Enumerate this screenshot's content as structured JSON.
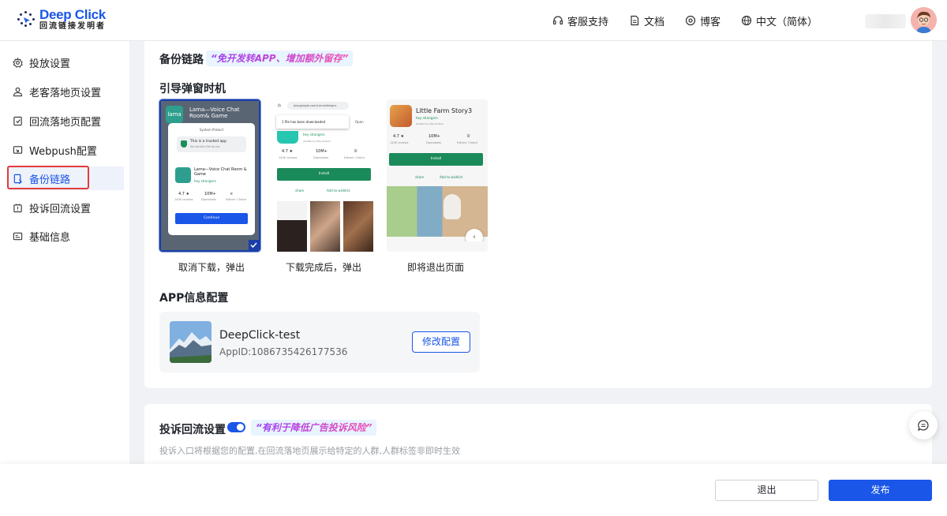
{
  "logo": {
    "brand": "Deep Click",
    "tagline": "回流链接发明者"
  },
  "nav": [
    {
      "label": "客服支持",
      "icon": "headset-icon"
    },
    {
      "label": "文档",
      "icon": "document-icon"
    },
    {
      "label": "博客",
      "icon": "compass-icon"
    },
    {
      "label": "中文（简体）",
      "icon": "globe-icon"
    }
  ],
  "sidebar": {
    "items": [
      {
        "label": "投放设置",
        "icon": "gear-icon"
      },
      {
        "label": "老客落地页设置",
        "icon": "user-cog-icon"
      },
      {
        "label": "回流落地页配置",
        "icon": "page-config-icon"
      },
      {
        "label": "Webpush配置",
        "icon": "push-icon"
      },
      {
        "label": "备份链路",
        "icon": "backup-icon",
        "active": true
      },
      {
        "label": "投诉回流设置",
        "icon": "complaint-icon"
      },
      {
        "label": "基础信息",
        "icon": "info-card-icon"
      }
    ]
  },
  "backup": {
    "title": "备份链路",
    "tag": "“免开发转APP、增加额外留存”",
    "popup_timing_title": "引导弹窗时机",
    "options": [
      {
        "caption": "取消下载，弹出",
        "selected": true
      },
      {
        "caption": "下载完成后，弹出",
        "selected": false
      },
      {
        "caption": "即将退出页面",
        "selected": false
      }
    ],
    "shot1": {
      "app_title": "Lama—Voice Chat Room& Game",
      "badge": "lama",
      "dialog_header": "System Protect",
      "trusted": "This is a trusted app",
      "no_harm": "No harmful file found",
      "app_name": "Lama—Voice Chat Room & Game",
      "dev": "hey strangers",
      "rating": "4.7 ★",
      "reviews": "140K reviews",
      "downloads_val": "10M+",
      "downloads": "Downloads",
      "editors": "Editors' Choice",
      "continue": "Continue"
    },
    "shot2": {
      "url": "play.google.com/t.ame/designs",
      "download_msg": "1 file has been downloaded",
      "open": "Open",
      "dev": "hey strangers",
      "verified": "Verified by Play Protect",
      "rating": "4.7 ★",
      "reviews": "140K reviews",
      "downloads_val": "10M+",
      "downloads": "Downloads",
      "editors": "Editors' Choice",
      "install": "Install",
      "share": "share",
      "wishlist": "Add to wishlist"
    },
    "shot3": {
      "app_name": "Little Farm Story3",
      "dev": "hey strangers",
      "verified": "Verified by Play Protect",
      "rating": "4.7 ★",
      "reviews": "140K reviews",
      "downloads_val": "10M+",
      "downloads": "Downloads",
      "editors": "Editors' Choice",
      "install": "Install",
      "share": "share",
      "wishlist": "Add to wishlist"
    },
    "app_config_title": "APP信息配置",
    "app": {
      "name": "DeepClick-test",
      "app_id": "AppID:1086735426177536",
      "edit_label": "修改配置"
    }
  },
  "complaint": {
    "title": "投诉回流设置",
    "enabled": true,
    "tag": "“有利于降低广告投诉风险”",
    "description": "投诉入口将根据您的配置,在回流落地页展示给特定的人群,人群标签非即时生效"
  },
  "footer": {
    "exit_label": "退出",
    "publish_label": "发布"
  },
  "colors": {
    "primary": "#1a56e8",
    "highlight_border": "#e23b3b",
    "tag_gradient_start": "#9b3bf5",
    "tag_gradient_end": "#f04fb0"
  }
}
